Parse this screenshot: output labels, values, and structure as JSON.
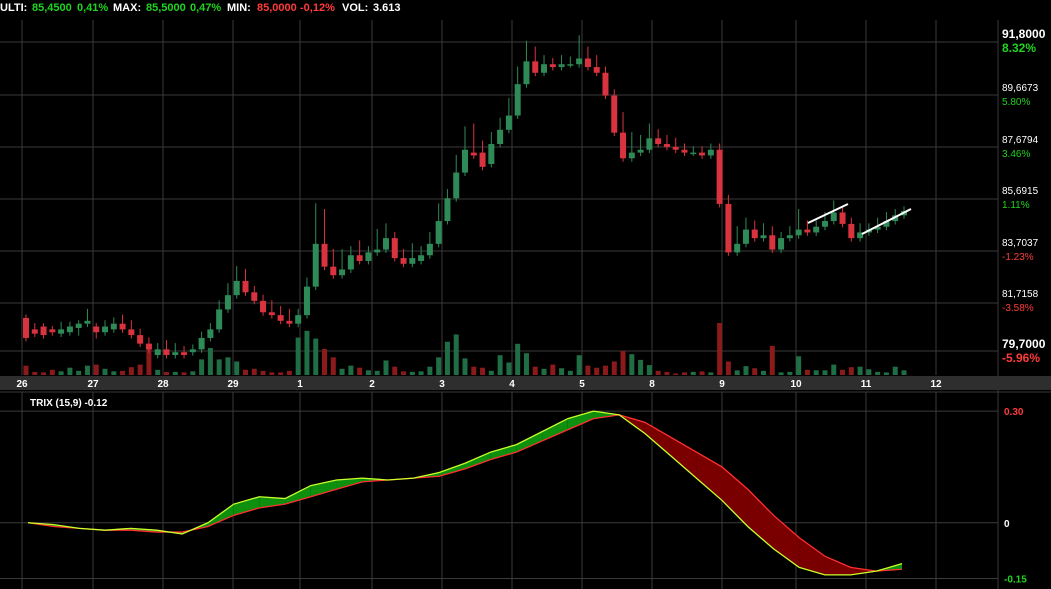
{
  "header": {
    "last_label": "ULTI:",
    "last_value": "85,4500",
    "last_change": "0,41%",
    "max_label": "MAX:",
    "max_value": "85,5000",
    "max_change": "0,47%",
    "min_label": "MIN:",
    "min_value": "85,0000",
    "min_change": "-0,12%",
    "vol_label": "VOL:",
    "vol_value": "3.613"
  },
  "colors": {
    "background": "#000000",
    "grid": "#3a3a3a",
    "up": "#2e8b57",
    "down": "#d9333f",
    "vol_up": "#1f6e45",
    "vol_down": "#8b1a1a",
    "positive_text": "#1ed41e",
    "negative_text": "#ff3b3b",
    "trix_line": "#c8ff2a",
    "signal_line": "#ff3030",
    "fill_up": "#0e8f0e",
    "fill_down": "#7a0000",
    "trendline": "#ffffff",
    "axis_bar": "#2e2e2e"
  },
  "chart_data": [
    {
      "type": "candlestick",
      "title": "",
      "x_tick_labels": [
        "26",
        "27",
        "28",
        "29",
        "1",
        "2",
        "3",
        "4",
        "5",
        "8",
        "9",
        "10",
        "11",
        "12"
      ],
      "ylim": [
        79.7,
        91.8
      ],
      "y_tick_labels": [
        "91,8000",
        "89,6673",
        "87,6794",
        "85,6915",
        "83,7037",
        "81,7158",
        "79,7000"
      ],
      "y_tick_percent": [
        "8.32%",
        "5.80%",
        "3.46%",
        "1.11%",
        "-1.23%",
        "-3.58%",
        "-5.96%"
      ],
      "grid": true,
      "candles": [
        [
          81.7,
          81.0,
          81.3
        ],
        [
          81.3,
          81.15,
          81.4
        ],
        [
          81.4,
          81.1,
          81.3
        ],
        [
          81.3,
          81.2,
          81.25
        ],
        [
          81.15,
          81.3,
          81.45
        ],
        [
          81.2,
          81.4,
          81.45
        ],
        [
          81.35,
          81.5,
          81.2
        ],
        [
          81.5,
          81.6,
          81.9
        ],
        [
          81.4,
          81.2,
          81.1
        ],
        [
          81.2,
          81.4,
          81.5
        ],
        [
          81.3,
          81.5,
          81.6
        ],
        [
          81.5,
          81.3,
          81.7
        ],
        [
          81.3,
          81.1,
          81.5
        ],
        [
          81.1,
          80.8,
          81.2
        ],
        [
          80.8,
          80.6,
          80.9
        ],
        [
          80.4,
          80.6,
          80.7
        ],
        [
          80.6,
          80.4,
          80.8
        ],
        [
          80.4,
          80.5,
          80.7
        ],
        [
          80.5,
          80.4,
          80.6
        ],
        [
          80.5,
          80.6,
          80.65
        ],
        [
          80.6,
          81.0,
          81.1
        ],
        [
          81.0,
          81.3,
          81.4
        ],
        [
          81.3,
          82.0,
          82.2
        ],
        [
          82.0,
          82.5,
          82.8
        ],
        [
          82.5,
          83.0,
          83.4
        ],
        [
          83.0,
          82.6,
          83.3
        ],
        [
          82.6,
          82.3,
          82.7
        ],
        [
          82.3,
          81.9,
          82.4
        ],
        [
          81.9,
          81.8,
          82.2
        ],
        [
          81.8,
          81.6,
          82.0
        ],
        [
          81.6,
          81.5,
          81.9
        ],
        [
          81.5,
          81.8,
          81.9
        ],
        [
          81.8,
          82.8,
          83.0
        ],
        [
          82.8,
          84.3,
          85.6
        ],
        [
          84.3,
          83.5,
          85.4
        ],
        [
          83.5,
          83.2,
          84.0
        ],
        [
          83.2,
          83.4,
          84.0
        ],
        [
          83.4,
          83.9,
          84.1
        ],
        [
          83.9,
          83.7,
          84.3
        ],
        [
          83.7,
          84.0,
          84.1
        ],
        [
          84.0,
          84.1,
          84.7
        ],
        [
          84.1,
          84.5,
          84.9
        ],
        [
          84.5,
          83.8,
          84.6
        ],
        [
          83.8,
          83.6,
          84.0
        ],
        [
          83.6,
          83.8,
          84.2
        ],
        [
          83.7,
          83.9,
          84.1
        ],
        [
          83.9,
          84.3,
          84.6
        ],
        [
          84.3,
          85.1,
          85.6
        ],
        [
          85.1,
          85.9,
          86.1
        ],
        [
          85.9,
          86.8,
          87.3
        ],
        [
          86.8,
          87.6,
          88.3
        ],
        [
          87.5,
          87.4,
          88.4
        ],
        [
          87.5,
          87.0,
          87.8
        ],
        [
          87.1,
          87.8,
          88.1
        ],
        [
          87.8,
          88.3,
          88.6
        ],
        [
          88.3,
          88.8,
          89.3
        ],
        [
          88.8,
          89.9,
          90.4
        ],
        [
          89.9,
          90.7,
          91.3
        ],
        [
          90.7,
          90.3,
          91.1
        ],
        [
          90.3,
          90.6,
          90.8
        ],
        [
          90.6,
          90.5,
          90.7
        ],
        [
          90.5,
          90.6,
          90.8
        ],
        [
          90.6,
          90.6,
          90.75
        ],
        [
          90.6,
          90.8,
          91.5
        ],
        [
          90.8,
          90.5,
          91.1
        ],
        [
          90.5,
          90.3,
          90.8
        ],
        [
          90.3,
          89.5,
          90.4
        ],
        [
          89.5,
          88.2,
          89.6
        ],
        [
          88.2,
          87.3,
          88.8
        ],
        [
          87.3,
          87.5,
          88.1
        ],
        [
          87.5,
          87.6,
          88.0
        ],
        [
          87.6,
          88.0,
          88.4
        ],
        [
          88.0,
          87.8,
          88.2
        ],
        [
          87.8,
          87.7,
          88.0
        ],
        [
          87.7,
          87.6,
          87.9
        ],
        [
          87.6,
          87.5,
          87.7
        ],
        [
          87.5,
          87.5,
          87.6
        ],
        [
          87.5,
          87.4,
          87.6
        ],
        [
          87.4,
          87.6,
          87.7
        ],
        [
          87.6,
          85.7,
          87.7
        ],
        [
          85.7,
          84.0,
          85.9
        ],
        [
          84.0,
          84.3,
          84.8
        ],
        [
          84.3,
          84.8,
          85.1
        ],
        [
          84.8,
          84.5,
          85.0
        ],
        [
          84.5,
          84.6,
          84.9
        ],
        [
          84.6,
          84.1,
          84.8
        ],
        [
          84.1,
          84.5,
          84.6
        ],
        [
          84.5,
          84.6,
          84.8
        ],
        [
          84.6,
          84.8,
          85.4
        ],
        [
          84.8,
          84.7,
          85.0
        ],
        [
          84.7,
          84.9,
          85.0
        ],
        [
          84.9,
          85.1,
          85.3
        ],
        [
          85.1,
          85.4,
          85.7
        ],
        [
          85.4,
          85.0,
          85.5
        ],
        [
          85.0,
          84.5,
          85.1
        ],
        [
          84.5,
          84.7,
          84.9
        ],
        [
          84.7,
          84.8,
          84.9
        ],
        [
          84.8,
          84.9,
          85.1
        ],
        [
          84.9,
          85.1,
          85.3
        ],
        [
          85.1,
          85.3,
          85.4
        ],
        [
          85.3,
          85.45,
          85.5
        ]
      ],
      "volumes": [
        0.18,
        0.06,
        0.05,
        0.1,
        0.07,
        0.14,
        0.08,
        0.18,
        0.2,
        0.12,
        0.07,
        0.08,
        0.15,
        0.2,
        0.58,
        0.1,
        0.06,
        0.06,
        0.05,
        0.07,
        0.3,
        0.52,
        0.3,
        0.34,
        0.26,
        0.1,
        0.12,
        0.08,
        0.05,
        0.05,
        0.08,
        0.72,
        0.85,
        0.7,
        0.5,
        0.34,
        0.12,
        0.18,
        0.14,
        0.09,
        0.08,
        0.28,
        0.16,
        0.07,
        0.06,
        0.07,
        0.16,
        0.34,
        0.64,
        0.78,
        0.32,
        0.16,
        0.14,
        0.08,
        0.38,
        0.24,
        0.6,
        0.42,
        0.16,
        0.12,
        0.2,
        0.13,
        0.08,
        0.38,
        0.18,
        0.14,
        0.18,
        0.26,
        0.46,
        0.4,
        0.29,
        0.19,
        0.08,
        0.06,
        0.03,
        0.05,
        0.06,
        0.07,
        0.05,
        1.0,
        0.26,
        0.09,
        0.17,
        0.13,
        0.08,
        0.56,
        0.05,
        0.06,
        0.36,
        0.1,
        0.09,
        0.09,
        0.2,
        0.1,
        0.15,
        0.16,
        0.11,
        0.06,
        0.05,
        0.16,
        0.09
      ]
    },
    {
      "type": "line",
      "title": "TRIX (15,9) -0.12",
      "ylim": [
        -0.17,
        0.33
      ],
      "y_tick_labels": [
        "0.30",
        "0",
        "-0.15"
      ],
      "grid": true,
      "series": [
        {
          "name": "TRIX",
          "values": [
            0.0,
            -0.005,
            -0.015,
            -0.02,
            -0.015,
            -0.02,
            -0.03,
            0.0,
            0.05,
            0.07,
            0.065,
            0.1,
            0.115,
            0.12,
            0.115,
            0.12,
            0.135,
            0.16,
            0.19,
            0.21,
            0.245,
            0.28,
            0.3,
            0.29,
            0.24,
            0.18,
            0.12,
            0.06,
            -0.01,
            -0.07,
            -0.12,
            -0.14,
            -0.14,
            -0.13,
            -0.11
          ]
        },
        {
          "name": "Signal",
          "values": [
            0.0,
            -0.01,
            -0.015,
            -0.02,
            -0.02,
            -0.025,
            -0.025,
            -0.01,
            0.02,
            0.04,
            0.05,
            0.07,
            0.09,
            0.11,
            0.115,
            0.12,
            0.125,
            0.145,
            0.17,
            0.19,
            0.22,
            0.25,
            0.28,
            0.29,
            0.27,
            0.23,
            0.19,
            0.15,
            0.09,
            0.02,
            -0.04,
            -0.09,
            -0.12,
            -0.13,
            -0.125
          ]
        }
      ]
    }
  ]
}
